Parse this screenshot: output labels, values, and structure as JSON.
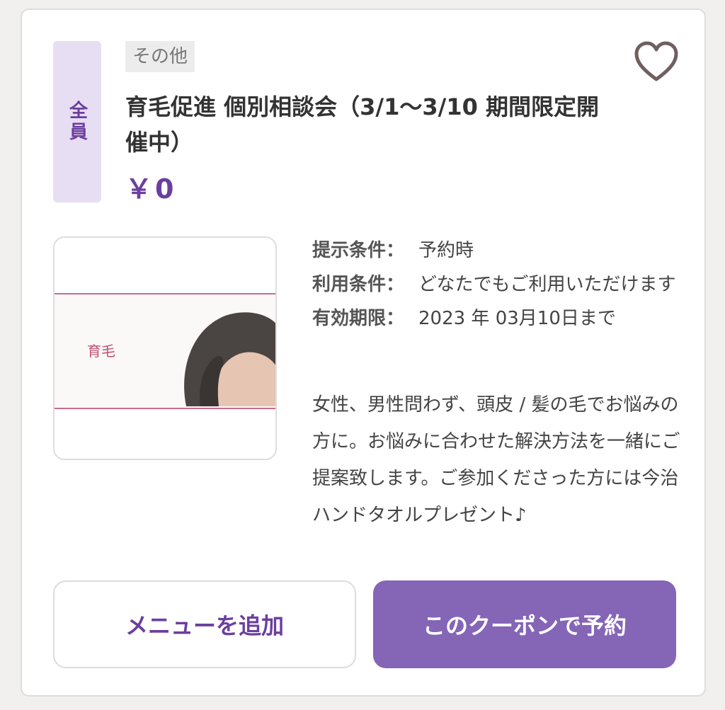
{
  "coupon": {
    "target": "全員",
    "category": "その他",
    "title": "育毛促進 個別相談会（3/1〜3/10 期間限定開催中）",
    "price": "￥0",
    "image_text": "育毛",
    "conditions": [
      {
        "label": "提示条件：",
        "value": "予約時"
      },
      {
        "label": "利用条件：",
        "value": "どなたでもご利用いただけます"
      },
      {
        "label": "有効期限：",
        "value": "2023 年 03月10日まで"
      }
    ],
    "description": "女性、男性問わず、頭皮 / 髪の毛でお悩みの方に。お悩みに合わせた解決方法を一緒にご提案致します。ご参加くださった方には今治ハンドタオルプレゼント♪",
    "favorite_icon": "heart-outline-icon"
  },
  "buttons": {
    "add_menu": "メニューを追加",
    "reserve": "このクーポンで予約"
  },
  "colors": {
    "accent": "#6b3f9e",
    "button_primary": "#8565b6",
    "badge_bg": "#e8def4"
  }
}
